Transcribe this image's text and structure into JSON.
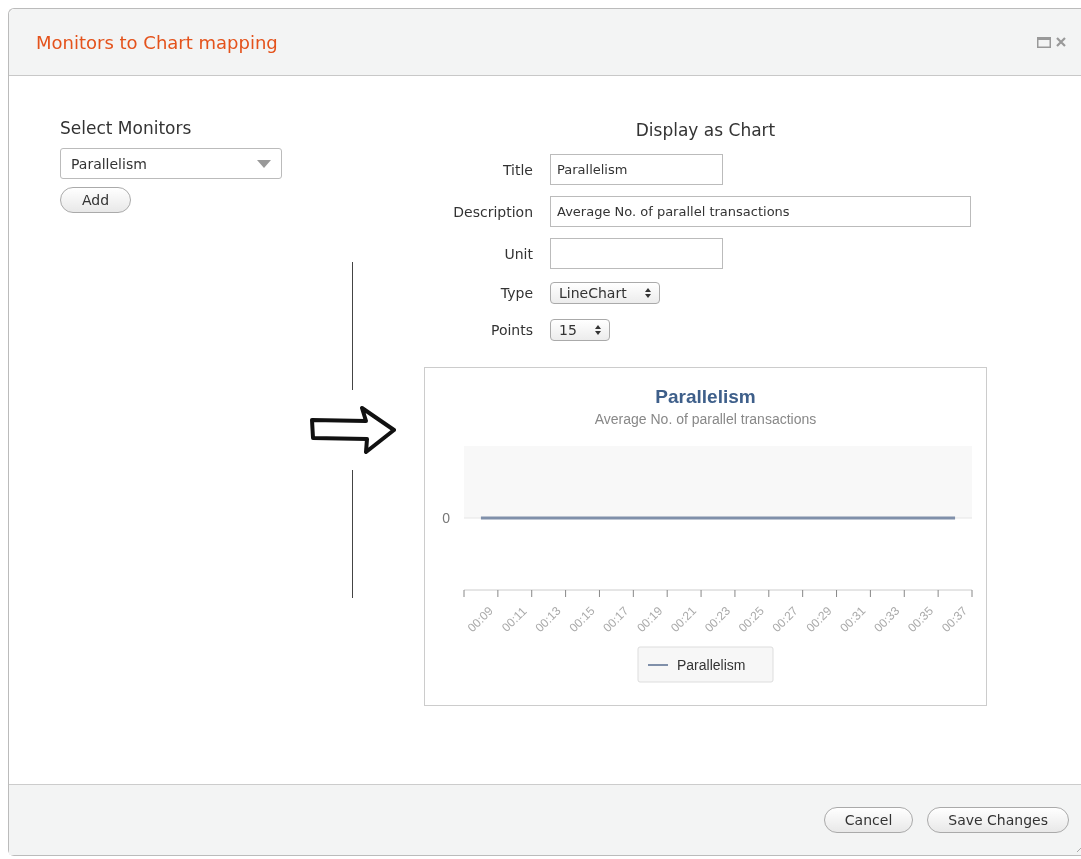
{
  "dialog": {
    "title": "Monitors to Chart mapping"
  },
  "select_monitors": {
    "heading": "Select Monitors",
    "dropdown_value": "Parallelism",
    "add_button": "Add"
  },
  "display": {
    "heading": "Display as Chart",
    "fields": [
      {
        "label": "Title",
        "kind": "text",
        "value": "Parallelism"
      },
      {
        "label": "Description",
        "kind": "text",
        "value": "Average No. of parallel transactions"
      },
      {
        "label": "Unit",
        "kind": "text"
      },
      {
        "label": "Type",
        "kind": "select",
        "value": "LineChart"
      },
      {
        "label": "Points",
        "kind": "select",
        "value": "15"
      }
    ],
    "chart": {
      "title": "Parallelism",
      "subtitle": "Average No. of parallel transactions",
      "y_axis_label": "0",
      "x_axis_labels": [
        "00:09",
        "00:11",
        "00:13",
        "00:15",
        "00:17",
        "00:19",
        "00:21",
        "00:23",
        "00:25",
        "00:27",
        "00:29",
        "00:31",
        "00:33",
        "00:35",
        "00:37"
      ],
      "legend": "Parallelism"
    }
  },
  "footer": {
    "buttons": [
      "Cancel",
      "Save Changes"
    ]
  }
}
